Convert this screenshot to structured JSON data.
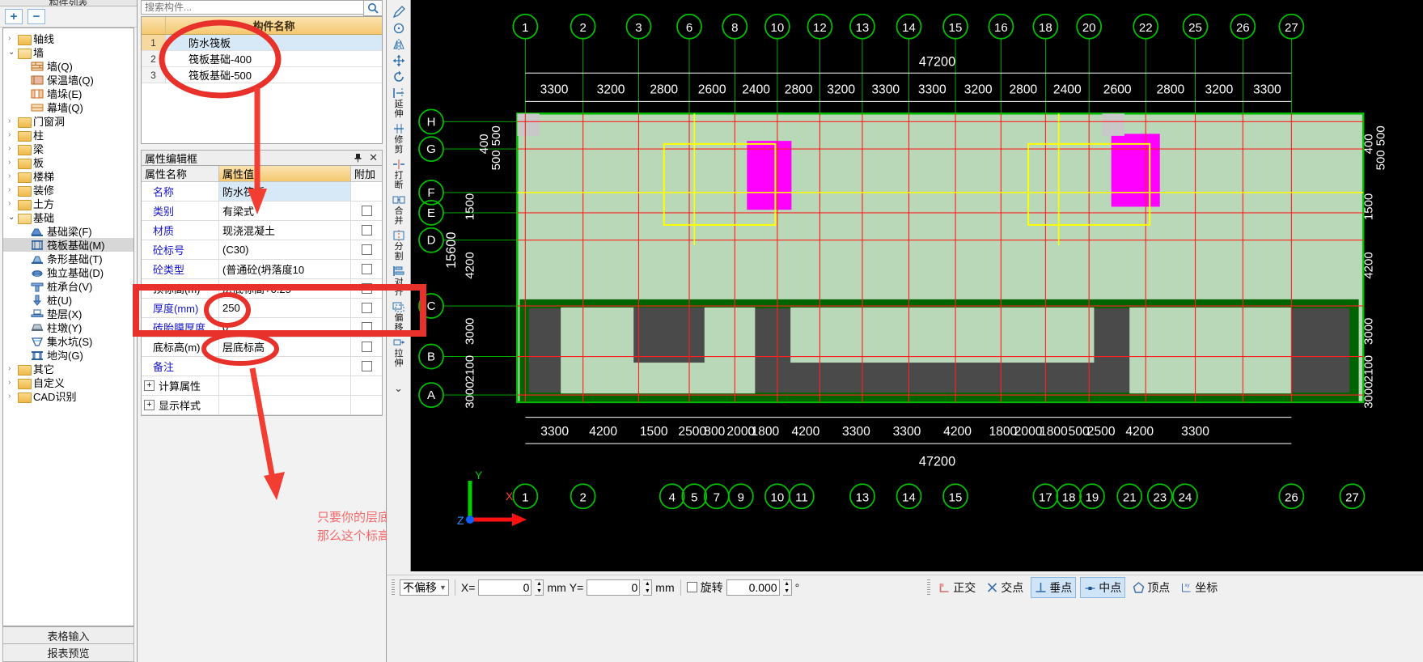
{
  "left_panel": {
    "title": "构件列表",
    "add_label": "+",
    "remove_label": "−",
    "tree": [
      {
        "label": "轴线",
        "level": 1,
        "type": "folder",
        "arrow": "right"
      },
      {
        "label": "墙",
        "level": 1,
        "type": "folder",
        "arrow": "down"
      },
      {
        "label": "墙(Q)",
        "level": 2,
        "type": "item",
        "icon": "wall-icon"
      },
      {
        "label": "保温墙(Q)",
        "level": 2,
        "type": "item",
        "icon": "insulation-wall-icon"
      },
      {
        "label": "墙垛(E)",
        "level": 2,
        "type": "item",
        "icon": "wall-pier-icon"
      },
      {
        "label": "幕墙(Q)",
        "level": 2,
        "type": "item",
        "icon": "curtain-wall-icon"
      },
      {
        "label": "门窗洞",
        "level": 1,
        "type": "folder",
        "arrow": "right"
      },
      {
        "label": "柱",
        "level": 1,
        "type": "folder",
        "arrow": "right"
      },
      {
        "label": "梁",
        "level": 1,
        "type": "folder",
        "arrow": "right"
      },
      {
        "label": "板",
        "level": 1,
        "type": "folder",
        "arrow": "right"
      },
      {
        "label": "楼梯",
        "level": 1,
        "type": "folder",
        "arrow": "right"
      },
      {
        "label": "装修",
        "level": 1,
        "type": "folder",
        "arrow": "right"
      },
      {
        "label": "土方",
        "level": 1,
        "type": "folder",
        "arrow": "right"
      },
      {
        "label": "基础",
        "level": 1,
        "type": "folder",
        "arrow": "down"
      },
      {
        "label": "基础梁(F)",
        "level": 2,
        "type": "item",
        "icon": "foundation-beam-icon"
      },
      {
        "label": "筏板基础(M)",
        "level": 2,
        "type": "item",
        "icon": "raft-foundation-icon",
        "selected": true
      },
      {
        "label": "条形基础(T)",
        "level": 2,
        "type": "item",
        "icon": "strip-foundation-icon"
      },
      {
        "label": "独立基础(D)",
        "level": 2,
        "type": "item",
        "icon": "isolated-foundation-icon"
      },
      {
        "label": "桩承台(V)",
        "level": 2,
        "type": "item",
        "icon": "pile-cap-icon"
      },
      {
        "label": "桩(U)",
        "level": 2,
        "type": "item",
        "icon": "pile-icon"
      },
      {
        "label": "垫层(X)",
        "level": 2,
        "type": "item",
        "icon": "cushion-icon"
      },
      {
        "label": "柱墩(Y)",
        "level": 2,
        "type": "item",
        "icon": "column-pier-icon"
      },
      {
        "label": "集水坑(S)",
        "level": 2,
        "type": "item",
        "icon": "sump-pit-icon"
      },
      {
        "label": "地沟(G)",
        "level": 2,
        "type": "item",
        "icon": "trench-icon"
      },
      {
        "label": "其它",
        "level": 1,
        "type": "folder",
        "arrow": "right"
      },
      {
        "label": "自定义",
        "level": 1,
        "type": "folder",
        "arrow": "right"
      },
      {
        "label": "CAD识别",
        "level": 1,
        "type": "folder",
        "arrow": "right"
      }
    ],
    "footer_buttons": [
      "表格输入",
      "报表预览"
    ]
  },
  "component_list": {
    "search_placeholder": "搜索构件...",
    "search_value": "",
    "column_header": "构件名称",
    "rows": [
      {
        "no": "1",
        "name": "防水筏板",
        "selected": true
      },
      {
        "no": "2",
        "name": "筏板基础-400",
        "selected": false
      },
      {
        "no": "3",
        "name": "筏板基础-500",
        "selected": false
      }
    ]
  },
  "property_editor": {
    "title": "属性编辑框",
    "pin_label": "📌",
    "close_label": "✕",
    "headers": {
      "name": "属性名称",
      "value": "属性值",
      "attach": "附加"
    },
    "rows": [
      {
        "name": "名称",
        "value": "防水筏板",
        "attach": false,
        "selected": true,
        "name_color": "blue"
      },
      {
        "name": "类别",
        "value": "有梁式",
        "attach": true,
        "name_color": "blue"
      },
      {
        "name": "材质",
        "value": "现浇混凝土",
        "attach": true,
        "name_color": "blue"
      },
      {
        "name": "砼标号",
        "value": "(C30)",
        "attach": true,
        "name_color": "blue"
      },
      {
        "name": "砼类型",
        "value": "(普通砼(坍落度10",
        "attach": true,
        "name_color": "blue"
      },
      {
        "name": "顶标高(m)",
        "value": "层底标高+0.25",
        "attach": true,
        "name_color": "black"
      },
      {
        "name": "厚度(mm)",
        "value": "250",
        "attach": true,
        "name_color": "blue"
      },
      {
        "name": "砖胎膜厚度",
        "value": "0",
        "attach": true,
        "name_color": "blue"
      },
      {
        "name": "底标高(m)",
        "value": "层底标高",
        "attach": true,
        "name_color": "black"
      },
      {
        "name": "备注",
        "value": "",
        "attach": true,
        "name_color": "blue"
      },
      {
        "name": "计算属性",
        "value": "",
        "expander": "+",
        "name_color": "black"
      },
      {
        "name": "显示样式",
        "value": "",
        "expander": "+",
        "name_color": "black"
      }
    ]
  },
  "annotation": {
    "line1": "只要你的层底标高设置的没问题。",
    "line2": "那么这个标高就不会有问题的。",
    "color": "#f56b6b"
  },
  "vertical_toolbar": {
    "items": [
      {
        "icon": "pen-icon",
        "label": ""
      },
      {
        "icon": "circle-icon",
        "label": ""
      },
      {
        "icon": "mirror-icon",
        "label": ""
      },
      {
        "icon": "move-icon",
        "label": ""
      },
      {
        "icon": "rotate-icon",
        "label": ""
      },
      {
        "icon": "extend-icon",
        "label": "延伸"
      },
      {
        "icon": "trim-icon",
        "label": "修剪"
      },
      {
        "icon": "break-icon",
        "label": "打断"
      },
      {
        "icon": "merge-icon",
        "label": "合并"
      },
      {
        "icon": "split-icon",
        "label": "分割"
      },
      {
        "icon": "align-icon",
        "label": "对齐"
      },
      {
        "icon": "offset-icon",
        "label": "偏移"
      },
      {
        "icon": "stretch-icon",
        "label": "拉伸"
      }
    ],
    "more_label": "⌄"
  },
  "status_bar": {
    "offset_mode": "不偏移",
    "x_label": "X=",
    "x_value": "0",
    "x_unit": "mm",
    "y_label": "Y=",
    "y_value": "0",
    "y_unit": "mm",
    "rotate_label": "旋转",
    "rotate_value": "0.000",
    "rotate_unit": "°",
    "snaps": [
      {
        "label": "正交",
        "icon": "ortho-icon",
        "active": false
      },
      {
        "label": "交点",
        "icon": "intersection-icon",
        "active": false
      },
      {
        "label": "垂点",
        "icon": "perpendicular-icon",
        "active": true
      },
      {
        "label": "中点",
        "icon": "midpoint-icon",
        "active": true
      },
      {
        "label": "顶点",
        "icon": "vertex-icon",
        "active": false
      },
      {
        "label": "坐标",
        "icon": "coordinate-icon",
        "active": false
      }
    ]
  },
  "canvas": {
    "background": "#000000",
    "axis_gizmo": {
      "x": "X",
      "y": "Y",
      "z": "Z"
    },
    "top_grid_labels": [
      "1",
      "2",
      "3",
      "6",
      "8",
      "10",
      "12",
      "13",
      "14",
      "15",
      "16",
      "18",
      "20",
      "22",
      "25",
      "26",
      "27"
    ],
    "bottom_grid_labels": [
      "1",
      "2",
      "4",
      "5",
      "7",
      "9",
      "10",
      "11",
      "13",
      "14",
      "15",
      "17",
      "18",
      "19",
      "21",
      "23",
      "24",
      "26",
      "27"
    ],
    "left_grid_labels": [
      "H",
      "G",
      "F",
      "E",
      "D",
      "C",
      "B",
      "A"
    ],
    "top_total": "47200",
    "bottom_total": "47200",
    "top_dims": [
      "3300",
      "3200",
      "2800",
      "2600",
      "2400",
      "2800",
      "3200",
      "3300",
      "3300",
      "3200",
      "2800",
      "2400",
      "2600",
      "2800",
      "3200",
      "3300"
    ],
    "bottom_dims": [
      "3300",
      "4200",
      "1500",
      "2500",
      "800",
      "2000",
      "1800",
      "4200",
      "3300",
      "3300",
      "4200",
      "1800",
      "2000",
      "1800",
      "500",
      "2500",
      "4200",
      "3300"
    ],
    "left_dims": [
      "500",
      "400",
      "500",
      "1500",
      "4200",
      "3000",
      "2100",
      "3000"
    ],
    "right_dims": [
      "500",
      "400",
      "500",
      "1500",
      "4200",
      "3000",
      "2100",
      "3000"
    ],
    "left_total": "15600"
  }
}
